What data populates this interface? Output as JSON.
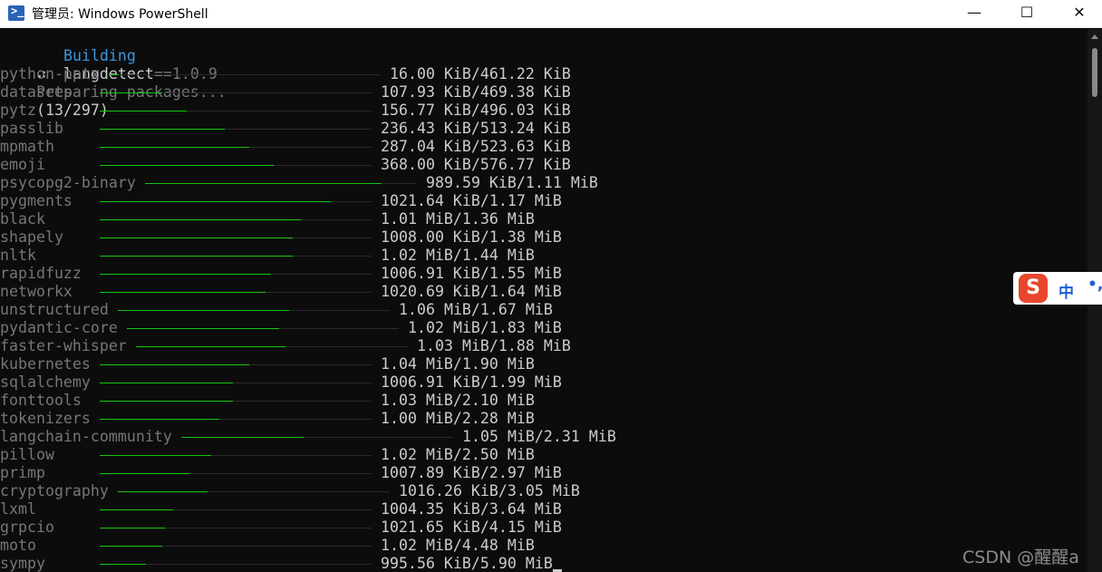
{
  "window": {
    "title": "管理员: Windows PowerShell",
    "app_icon": "powershell-icon",
    "minimize_label": "—",
    "maximize_label": "☐",
    "close_label": "✕"
  },
  "console": {
    "building_keyword": "Building",
    "building_package": "langdetect",
    "building_version": "==1.0.9",
    "preparing_text": "Preparing packages...",
    "preparing_count": "(13/297)",
    "colors": {
      "bar_fill": "#16c60c",
      "bar_track": "#2a2a2a",
      "package": "#767676",
      "keyword": "#3a96dd"
    },
    "downloads": [
      {
        "name": "python-pptx",
        "progress": 0.035,
        "size": "16.00 KiB/461.22 KiB"
      },
      {
        "name": "datasets",
        "progress": 0.23,
        "size": "107.93 KiB/469.38 KiB"
      },
      {
        "name": "pytz",
        "progress": 0.32,
        "size": "156.77 KiB/496.03 KiB"
      },
      {
        "name": "passlib",
        "progress": 0.46,
        "size": "236.43 KiB/513.24 KiB"
      },
      {
        "name": "mpmath",
        "progress": 0.55,
        "size": "287.04 KiB/523.63 KiB"
      },
      {
        "name": "emoji",
        "progress": 0.64,
        "size": "368.00 KiB/576.77 KiB"
      },
      {
        "name": "psycopg2-binary",
        "progress": 0.87,
        "size": "989.59 KiB/1.11 MiB"
      },
      {
        "name": "pygments",
        "progress": 0.85,
        "size": "1021.64 KiB/1.17 MiB"
      },
      {
        "name": "black",
        "progress": 0.74,
        "size": "1.01 MiB/1.36 MiB"
      },
      {
        "name": "shapely",
        "progress": 0.71,
        "size": "1008.00 KiB/1.38 MiB"
      },
      {
        "name": "nltk",
        "progress": 0.71,
        "size": "1.02 MiB/1.44 MiB"
      },
      {
        "name": "rapidfuzz",
        "progress": 0.63,
        "size": "1006.91 KiB/1.55 MiB"
      },
      {
        "name": "networkx",
        "progress": 0.61,
        "size": "1020.69 KiB/1.64 MiB"
      },
      {
        "name": "unstructured",
        "progress": 0.63,
        "size": "1.06 MiB/1.67 MiB"
      },
      {
        "name": "pydantic-core",
        "progress": 0.56,
        "size": "1.02 MiB/1.83 MiB"
      },
      {
        "name": "faster-whisper",
        "progress": 0.55,
        "size": "1.03 MiB/1.88 MiB"
      },
      {
        "name": "kubernetes",
        "progress": 0.55,
        "size": "1.04 MiB/1.90 MiB"
      },
      {
        "name": "sqlalchemy",
        "progress": 0.49,
        "size": "1006.91 KiB/1.99 MiB"
      },
      {
        "name": "fonttools",
        "progress": 0.49,
        "size": "1.03 MiB/2.10 MiB"
      },
      {
        "name": "tokenizers",
        "progress": 0.44,
        "size": "1.00 MiB/2.28 MiB"
      },
      {
        "name": "langchain-community",
        "progress": 0.45,
        "size": "1.05 MiB/2.31 MiB"
      },
      {
        "name": "pillow",
        "progress": 0.41,
        "size": "1.02 MiB/2.50 MiB"
      },
      {
        "name": "primp",
        "progress": 0.33,
        "size": "1007.89 KiB/2.97 MiB"
      },
      {
        "name": "cryptography",
        "progress": 0.33,
        "size": "1016.26 KiB/3.05 MiB"
      },
      {
        "name": "lxml",
        "progress": 0.27,
        "size": "1004.35 KiB/3.64 MiB"
      },
      {
        "name": "grpcio",
        "progress": 0.24,
        "size": "1021.65 KiB/4.15 MiB"
      },
      {
        "name": "moto",
        "progress": 0.23,
        "size": "1.02 MiB/4.48 MiB"
      },
      {
        "name": "sympy",
        "progress": 0.17,
        "size": "995.56 KiB/5.90 MiB"
      }
    ]
  },
  "ime": {
    "logo": "S",
    "mode": "中",
    "punct": "•,"
  },
  "watermark": "CSDN @醒醒a"
}
